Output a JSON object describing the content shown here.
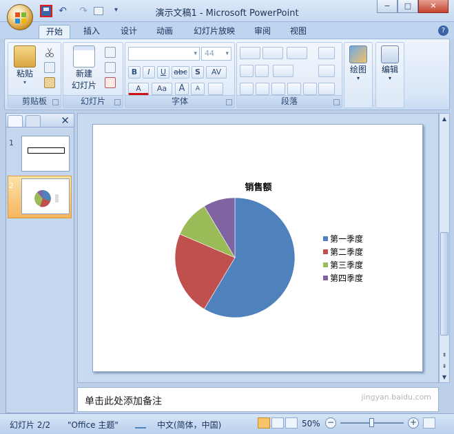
{
  "window": {
    "title": "演示文稿1 - Microsoft PowerPoint",
    "min_label": "−",
    "max_label": "□",
    "close_label": "✕"
  },
  "quick_access": {
    "undo": "↶",
    "redo": "↷",
    "more": "▾"
  },
  "tabs": [
    "开始",
    "插入",
    "设计",
    "动画",
    "幻灯片放映",
    "审阅",
    "视图"
  ],
  "help_label": "?",
  "ribbon": {
    "clipboard": {
      "paste": "粘贴",
      "group": "剪贴板"
    },
    "slides": {
      "new_slide_line1": "新建",
      "new_slide_line2": "幻灯片",
      "group": "幻灯片"
    },
    "font": {
      "size": "44",
      "bold": "B",
      "italic": "I",
      "underline": "U",
      "strike": "abc",
      "shadow": "S",
      "spacing": "AV",
      "color": "A",
      "case": "Aa",
      "grow": "A",
      "shrink": "A",
      "group": "字体"
    },
    "paragraph": {
      "group": "段落"
    },
    "drawing": {
      "label": "绘图"
    },
    "editing": {
      "label": "编辑"
    }
  },
  "left_panel": {
    "close": "✕",
    "slide_numbers": [
      "1",
      "2"
    ]
  },
  "chart_data": {
    "type": "pie",
    "title": "销售额",
    "categories": [
      "第一季度",
      "第二季度",
      "第三季度",
      "第四季度"
    ],
    "values": [
      8.2,
      3.2,
      1.4,
      1.2
    ],
    "colors": [
      "#4f81bd",
      "#c0504d",
      "#9bbb59",
      "#8064a2"
    ],
    "legend_position": "right"
  },
  "notes_placeholder": "单击此处添加备注",
  "status": {
    "slide_info": "幻灯片 2/2",
    "theme": "\"Office 主题\"",
    "language": "中文(简体，中国)",
    "zoom": "50%",
    "zoom_out": "−",
    "zoom_in": "+"
  },
  "watermark": "jingyan.baidu.com"
}
